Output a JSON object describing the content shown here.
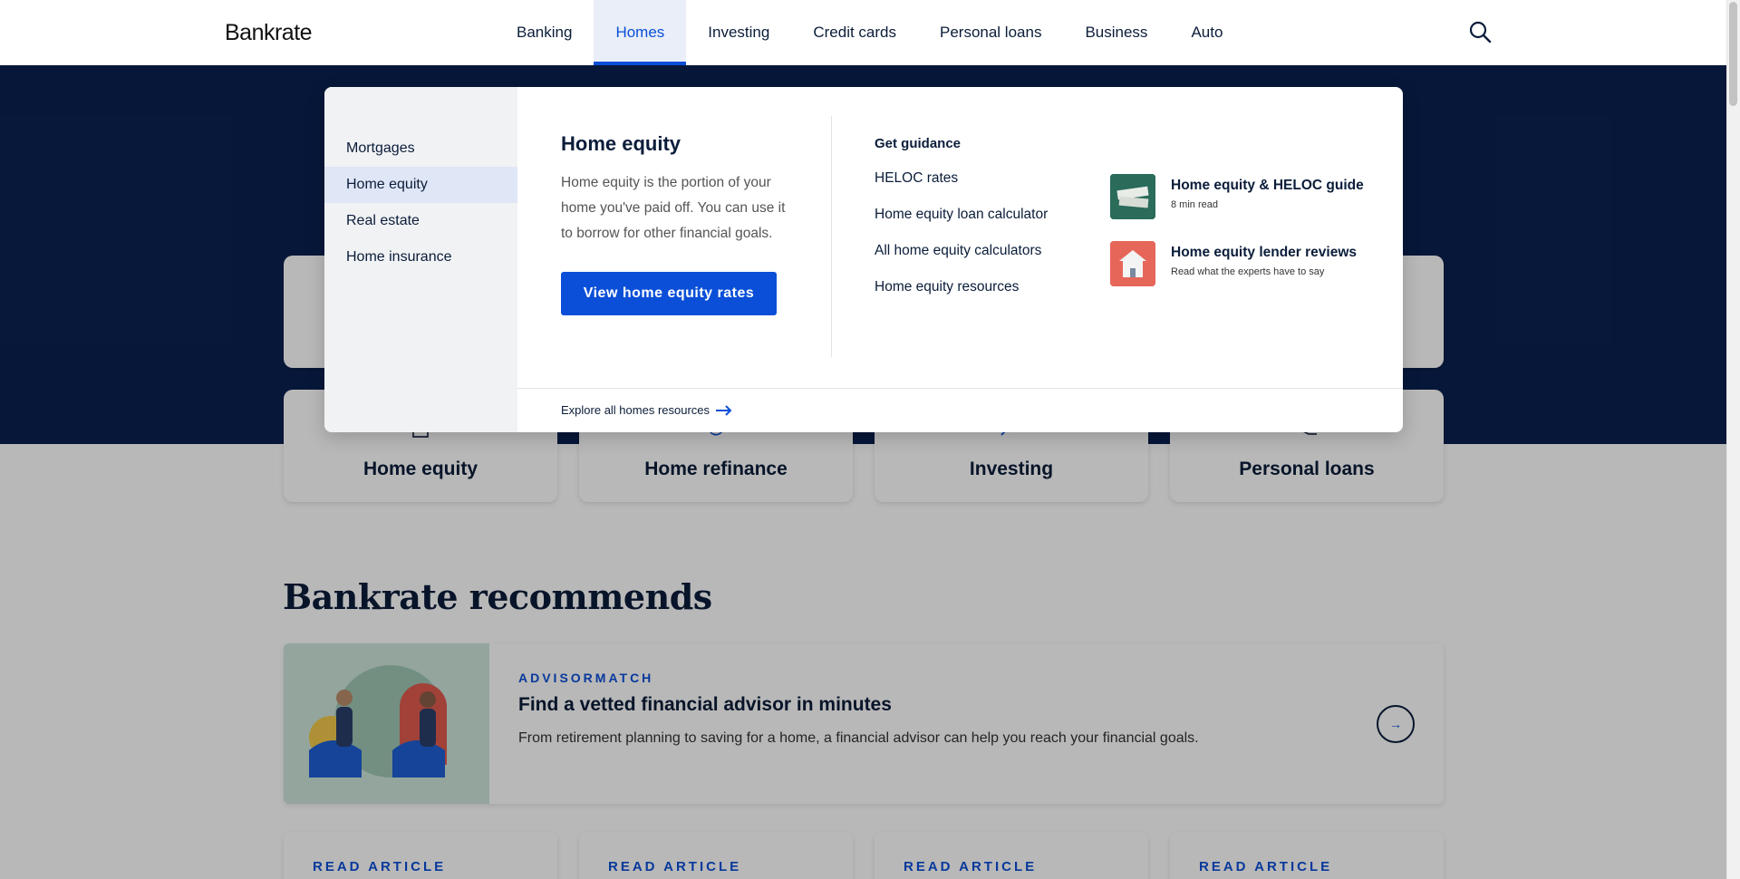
{
  "header": {
    "logo": "Bankrate",
    "nav": [
      "Banking",
      "Homes",
      "Investing",
      "Credit cards",
      "Personal loans",
      "Business",
      "Auto"
    ],
    "active_nav": "Homes"
  },
  "menu": {
    "side_items": [
      "Mortgages",
      "Home equity",
      "Real estate",
      "Home insurance"
    ],
    "active_side": "Home equity",
    "section_title": "Home equity",
    "section_desc": "Home equity is the portion of your home you've paid off. You can use it to borrow for other financial goals.",
    "cta_label": "View home equity rates",
    "guidance_title": "Get guidance",
    "guidance_links": [
      "HELOC rates",
      "Home equity loan calculator",
      "All home equity calculators",
      "Home equity resources"
    ],
    "featured": [
      {
        "title": "Home equity & HELOC guide",
        "sub": "8 min read"
      },
      {
        "title": "Home equity lender reviews",
        "sub": "Read what the experts have to say"
      }
    ],
    "explore_label": "Explore all homes resources"
  },
  "tiles": [
    "Home equity",
    "Home refinance",
    "Investing",
    "Personal loans"
  ],
  "recommends": {
    "title": "Bankrate recommends",
    "kicker": "ADVISORMATCH",
    "heading": "Find a vetted financial advisor in minutes",
    "desc": "From retirement planning to saving for a home, a financial advisor can help you reach your financial goals."
  },
  "articles": [
    "READ ARTICLE",
    "READ ARTICLE",
    "READ ARTICLE",
    "READ ARTICLE"
  ],
  "colors": {
    "brand_blue": "#0b4fd8",
    "hero_navy": "#0b2150",
    "text_dark": "#0b1d3a"
  }
}
